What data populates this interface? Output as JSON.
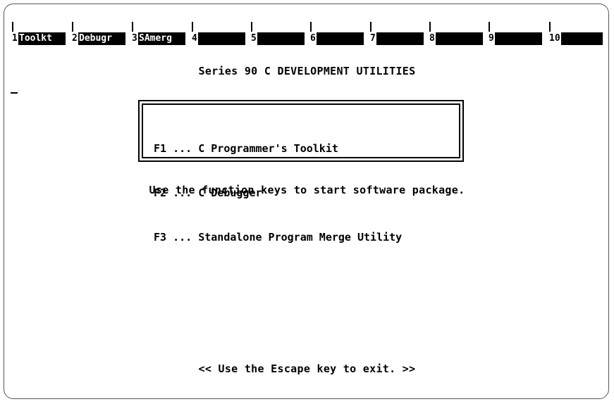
{
  "function_keys": [
    {
      "number": "1",
      "label": "Toolkt"
    },
    {
      "number": "2",
      "label": "Debugr"
    },
    {
      "number": "3",
      "label": "SAmerg"
    },
    {
      "number": "4",
      "label": ""
    },
    {
      "number": "5",
      "label": ""
    },
    {
      "number": "6",
      "label": ""
    },
    {
      "number": "7",
      "label": ""
    },
    {
      "number": "8",
      "label": ""
    },
    {
      "number": "9",
      "label": ""
    },
    {
      "number": "10",
      "label": ""
    }
  ],
  "title": "Series 90 C DEVELOPMENT UTILITIES",
  "menu": [
    {
      "key": "F1",
      "text": "C Programmer's Toolkit"
    },
    {
      "key": "F2",
      "text": "C Debugger"
    },
    {
      "key": "F3",
      "text": "Standalone Program Merge Utility"
    }
  ],
  "menu_separator": "...",
  "hint": "Use the function keys to start software package.",
  "footer": "<< Use the Escape key to exit. >>"
}
